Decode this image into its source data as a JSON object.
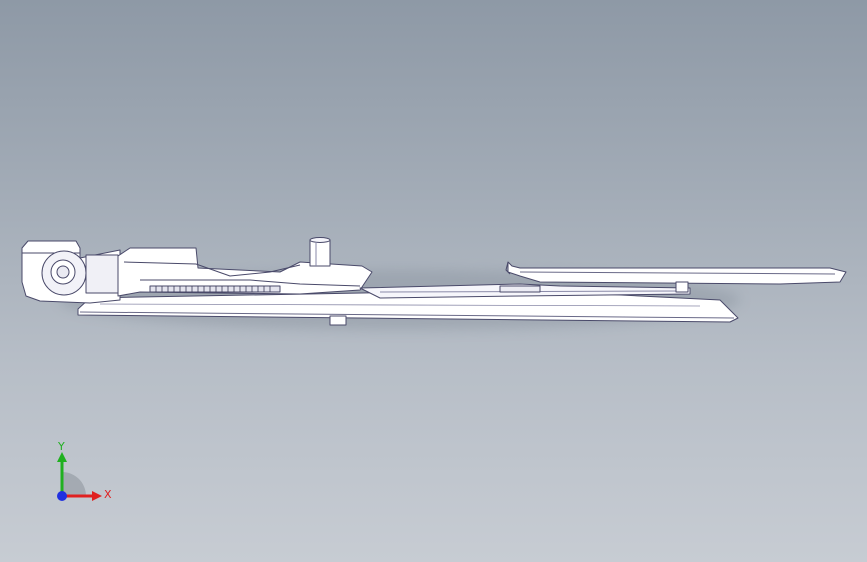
{
  "viewport": {
    "background_top": "#8e99a6",
    "background_bottom": "#c7ccd3"
  },
  "model": {
    "body_fill": "#ffffff",
    "edge_color": "#4a4a6a",
    "shade_color": "#dcdce8"
  },
  "triad": {
    "x_label": "X",
    "y_label": "Y",
    "x_color": "#e02020",
    "y_color": "#20b020",
    "z_color": "#2030e0"
  }
}
